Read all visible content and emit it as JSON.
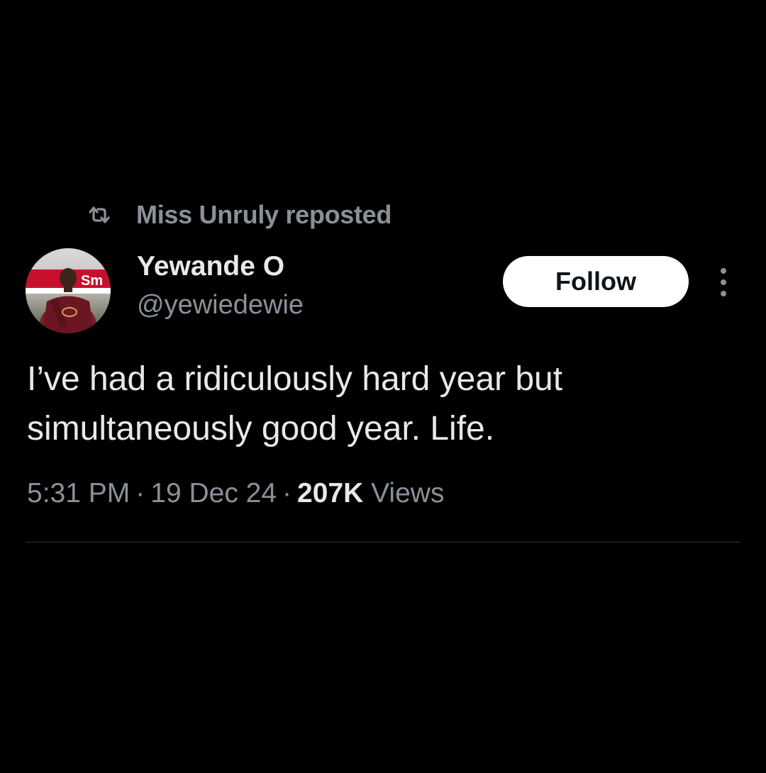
{
  "repost": {
    "icon": "repost-icon",
    "text": "Miss Unruly reposted"
  },
  "author": {
    "name": "Yewande O",
    "handle": "@yewiedewie",
    "avatar": "avatar-photo"
  },
  "actions": {
    "follow_label": "Follow",
    "more_icon": "more-options-icon"
  },
  "tweet": {
    "text": "I’ve had a ridiculously hard year but simultaneously good year. Life."
  },
  "meta": {
    "time": "5:31 PM",
    "separator": "·",
    "date": "19 Dec 24",
    "views_count": "207K",
    "views_label": "Views"
  },
  "colors": {
    "background": "#000000",
    "primary_text": "#e7e9ea",
    "secondary_text": "#8b9098",
    "follow_bg": "#ffffff",
    "follow_text": "#0f1419",
    "divider": "#2f3336"
  }
}
